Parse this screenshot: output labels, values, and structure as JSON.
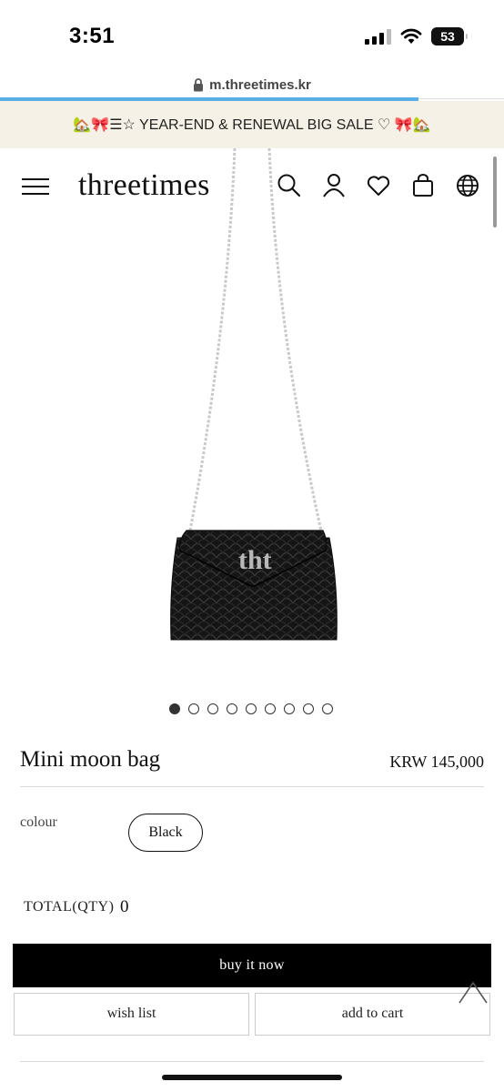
{
  "status_bar": {
    "time": "3:51",
    "battery": "53",
    "icons": [
      "cellular-signal-icon",
      "wifi-icon",
      "battery-icon"
    ]
  },
  "browser": {
    "url": "m.threetimes.kr",
    "lock_icon": "lock-icon",
    "load_progress": 0.83
  },
  "promo": {
    "text": "🏡🎀☰☆ YEAR-END & RENEWAL BIG SALE ♡ 🎀🏡",
    "background": "#f6f1e6"
  },
  "header": {
    "logo": "threetimes",
    "icons": [
      "menu-icon",
      "search-icon",
      "account-icon",
      "heart-icon",
      "shopping-bag-icon",
      "globe-icon"
    ]
  },
  "gallery": {
    "total_slides": 9,
    "active_index": 0,
    "image_logo_text": "tht"
  },
  "product": {
    "name": "Mini moon bag",
    "price": "KRW 145,000",
    "option_label": "colour",
    "option_value": "Black",
    "total_label": "TOTAL(QTY)",
    "total_qty": "0"
  },
  "actions": {
    "buy_now": "buy it now",
    "wish_list": "wish list",
    "add_to_cart": "add to cart",
    "scroll_top_icon": "chevron-up-icon"
  },
  "colors": {
    "accent": "#000000",
    "progress": "#5aaee6",
    "banner": "#f6f1e6"
  }
}
